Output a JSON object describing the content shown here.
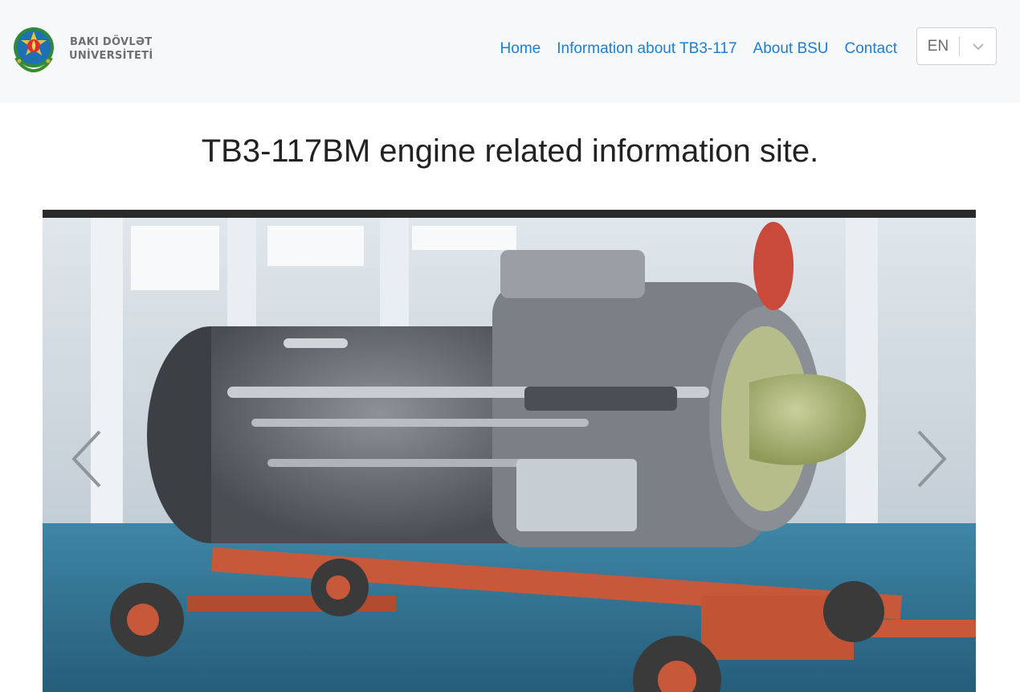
{
  "header": {
    "university_line1": "BAKI DÖVLƏT",
    "university_line2": "UNİVERSİTETİ",
    "nav": [
      {
        "label": "Home"
      },
      {
        "label": "Information about TB3-117"
      },
      {
        "label": "About BSU"
      },
      {
        "label": "Contact"
      }
    ],
    "language": {
      "selected": "EN"
    }
  },
  "main": {
    "title": "TB3-117BM engine related information site."
  },
  "carousel": {
    "prev_icon": "chevron-left-icon",
    "next_icon": "chevron-right-icon"
  },
  "colors": {
    "link": "#1a7fd6",
    "navbar_bg": "#f7f8fa",
    "engine_cradle": "#c8583a",
    "floor": "#2f6c8c"
  }
}
